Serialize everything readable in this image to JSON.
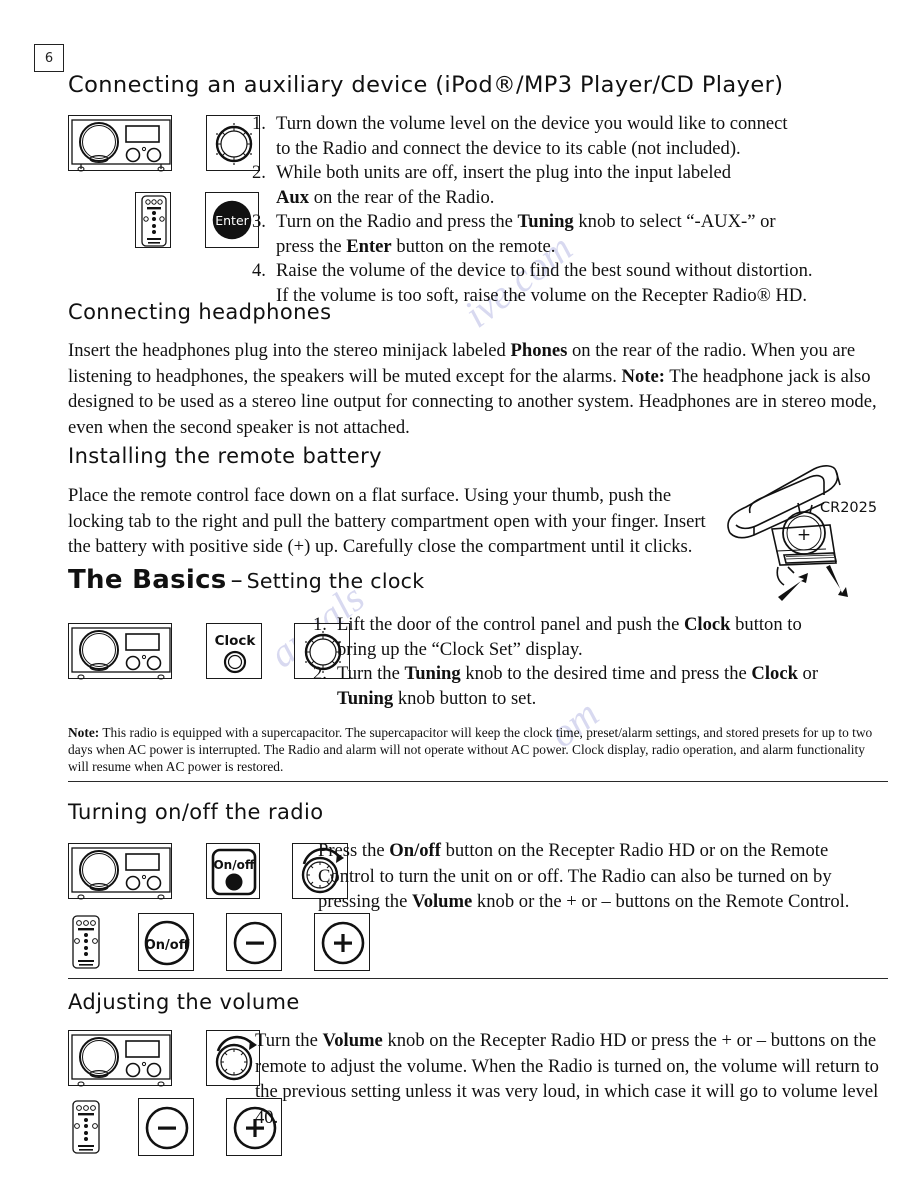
{
  "page": {
    "number": "6"
  },
  "watermark": {
    "line1": "ive.com",
    "line2": "anuals",
    "line3": "om"
  },
  "sections": {
    "aux": {
      "heading": "Connecting an auxiliary device (iPod®/MP3 Player/CD Player)",
      "steps": [
        {
          "num": "1.",
          "line1": "Turn down the volume level on the device you would like to connect",
          "line2": "to the Radio and connect the device to its cable (not included)."
        },
        {
          "num": "2.",
          "line1": "While both units are off, insert the plug into the input labeled",
          "line2_bold": "Aux",
          "line2_rest": " on the rear of the Radio."
        },
        {
          "num": "3.",
          "line1_a": "Turn on the Radio and press the ",
          "line1_bold": "Tuning",
          "line1_b": " knob to select “-AUX-” or",
          "line2_a": "press the ",
          "line2_bold": "Enter",
          "line2_b": " button on the remote."
        },
        {
          "num": "4.",
          "line1": "Raise the volume of the device to find the best sound without distortion.",
          "line2": "If the volume is too soft, raise the volume on the Recepter Radio® HD."
        }
      ],
      "icons": [
        {
          "name": "radio-front-icon",
          "label": ""
        },
        {
          "name": "tuning-knob-icon",
          "label": ""
        },
        {
          "name": "remote-control-icon",
          "label": ""
        },
        {
          "name": "enter-button-icon",
          "label": "Enter"
        }
      ]
    },
    "headphones": {
      "heading": "Connecting headphones",
      "para_a": "Insert the headphones plug into the stereo minijack labeled ",
      "para_bold1": "Phones",
      "para_b": " on the rear of the radio. When you are listening to headphones, the speakers will be muted except for the alarms. ",
      "para_bold2": "Note:",
      "para_c": " The headphone jack is also designed to be used as a stereo line output for connecting to another system. Headphones are in stereo mode, even when the second speaker is not attached."
    },
    "battery": {
      "heading": "Installing the remote battery",
      "para": "Place the remote control face down on a flat surface. Using your thumb, push the locking tab to the right and pull the battery compartment open with your finger. Insert the battery with positive side (+) up. Carefully close the compartment until it clicks.",
      "illustration_label": "CR2025",
      "battery_polarity": "+"
    },
    "basics": {
      "heading_big": "The Basics",
      "heading_dash": "–",
      "heading_small": "Setting the clock",
      "steps": [
        {
          "num": "1.",
          "line1_a": "Lift the door of the control panel and push the ",
          "line1_bold": "Clock",
          "line1_b": " button to",
          "line2": "bring up the “Clock Set” display."
        },
        {
          "num": "2.",
          "line1_a": "Turn the ",
          "line1_bold": "Tuning",
          "line1_b": " knob to the desired time and press the ",
          "line1_bold2": "Clock",
          "line1_c": " or",
          "line2_bold": "Tuning",
          "line2_rest": " knob button to set."
        }
      ],
      "icons": [
        {
          "name": "radio-front-icon",
          "label": ""
        },
        {
          "name": "clock-button-icon",
          "label": "Clock"
        },
        {
          "name": "tuning-knob-icon",
          "label": ""
        }
      ]
    },
    "note": {
      "bold": "Note:",
      "text": " This radio is equipped with a supercapacitor. The supercapacitor will keep the clock time, preset/alarm settings, and stored presets for up to two days when AC power is interrupted. The Radio and alarm will not operate without AC power. Clock display, radio operation, and alarm functionality will resume when AC power is restored."
    },
    "onoff": {
      "heading": "Turning on/off the radio",
      "para_a": "Press the ",
      "para_bold1": "On/off",
      "para_b": " button on the Recepter Radio HD or on the Remote Control to turn the unit on or off. The Radio can also be turned on by pressing the ",
      "para_bold2": "Volume",
      "para_c": " knob or the + or – buttons on the Remote Control.",
      "icons": [
        {
          "name": "radio-front-icon",
          "label": ""
        },
        {
          "name": "onoff-panel-button-icon",
          "label": "On/off"
        },
        {
          "name": "volume-knob-icon",
          "label": ""
        },
        {
          "name": "remote-control-icon",
          "label": ""
        },
        {
          "name": "remote-onoff-button-icon",
          "label": "On/off"
        },
        {
          "name": "minus-button-icon",
          "label": "–"
        },
        {
          "name": "plus-button-icon",
          "label": "+"
        }
      ]
    },
    "volume": {
      "heading": "Adjusting the volume",
      "para_a": "Turn the ",
      "para_bold": "Volume",
      "para_b": " knob on the Recepter Radio HD or press the + or – buttons on the remote to adjust the volume. When the Radio is turned on, the volume will return to the previous setting unless it was very loud, in which case it will go to volume level 40.",
      "icons": [
        {
          "name": "radio-front-icon",
          "label": ""
        },
        {
          "name": "volume-knob-icon",
          "label": ""
        },
        {
          "name": "remote-control-icon",
          "label": ""
        },
        {
          "name": "minus-button-icon",
          "label": "–"
        },
        {
          "name": "plus-button-icon",
          "label": "+"
        }
      ]
    }
  },
  "colors": {
    "ink": "#111111",
    "rule": "#2a2a2a",
    "watermark": "#b9bbe4"
  }
}
